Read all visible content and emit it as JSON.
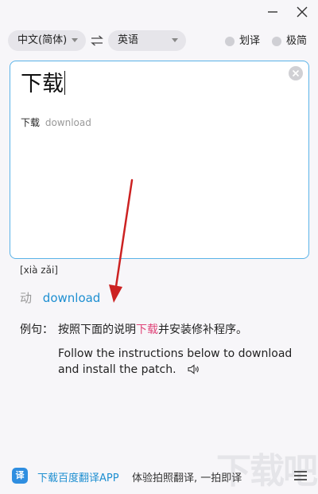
{
  "window": {
    "minimize_icon": "minimize-icon",
    "close_icon": "close-icon"
  },
  "lang_bar": {
    "source_language": "中文(简体)",
    "target_language": "英语",
    "swap_icon": "swap-arrows-icon",
    "toggles": [
      {
        "label": "划译",
        "on": false
      },
      {
        "label": "极简",
        "on": false
      }
    ]
  },
  "input": {
    "text": "下载",
    "clear_icon": "clear-icon",
    "suggestion": {
      "word": "下载",
      "translation": "download"
    }
  },
  "result": {
    "phonetic": "[xià zǎi]",
    "part_of_speech": "动",
    "meaning": "download",
    "example_label": "例句：",
    "example_zh_before": "按照下面的说明",
    "example_zh_highlight": "下载",
    "example_zh_after": "并安装修补程序。",
    "example_en": "Follow the instructions below to download and install the patch.",
    "speaker_icon": "speaker-icon"
  },
  "footer": {
    "app_icon_text": "译",
    "download_link": "下载百度翻译APP",
    "slogan": "体验拍照翻译, 一拍即译",
    "menu_icon": "menu-icon"
  },
  "watermark": "下载吧",
  "colors": {
    "accent_blue": "#1e8fd1",
    "input_border": "#5ab3e8",
    "highlight_pink": "#e0457a",
    "annotation_arrow": "#cc2222"
  }
}
